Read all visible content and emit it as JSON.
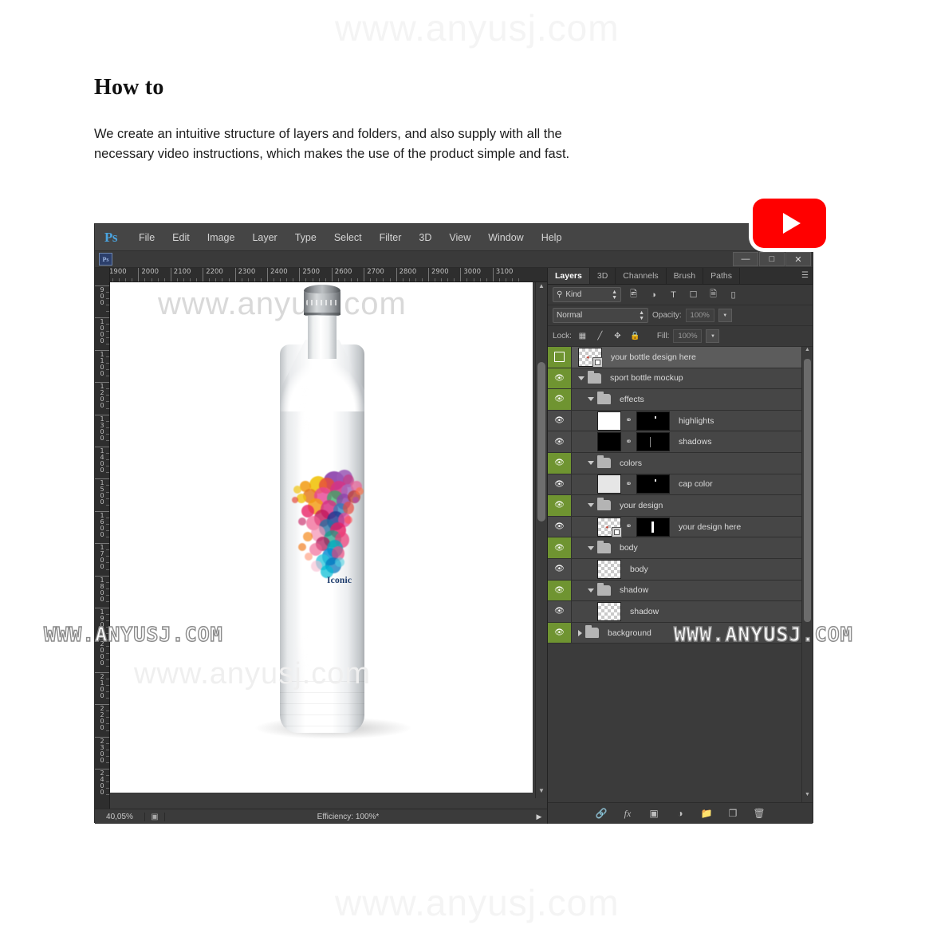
{
  "page": {
    "heading": "How to",
    "body": "We create an intuitive structure of layers and folders, and also supply with all the necessary video instructions, which makes the use of the product simple and fast.",
    "watermark_lower": "www.anyusj.com",
    "watermark_upper": "WWW.ANYUSJ.COM"
  },
  "youtube": {
    "name": "youtube-play-button"
  },
  "photoshop": {
    "app_logo": "Ps",
    "menu": [
      "File",
      "Edit",
      "Image",
      "Layer",
      "Type",
      "Select",
      "Filter",
      "3D",
      "View",
      "Window",
      "Help"
    ],
    "window_controls": {
      "minimize": "—",
      "maximize": "□",
      "close": "✕"
    },
    "document_icon": "Ps",
    "ruler_h": {
      "ticks": [
        1900,
        2000,
        2100,
        2200,
        2300,
        2400,
        2500,
        2600,
        2700,
        2800,
        2900,
        3000,
        3100
      ],
      "unit": "px"
    },
    "ruler_v": {
      "ticks": [
        900,
        1000,
        1100,
        1200,
        1300,
        1400,
        1500,
        1600,
        1700,
        1800,
        1900,
        2000,
        2100,
        2200,
        2300,
        2400
      ]
    },
    "status": {
      "zoom": "40,05%",
      "efficiency": "Efficiency: 100%*"
    },
    "canvas": {
      "product": "sport bottle",
      "artwork_label": "Iconic",
      "artwork_name": "watercolor-runner-splash"
    }
  },
  "layers_panel": {
    "tabs": [
      {
        "label": "Layers",
        "active": true
      },
      {
        "label": "3D",
        "active": false
      },
      {
        "label": "Channels",
        "active": false
      },
      {
        "label": "Brush",
        "active": false
      },
      {
        "label": "Paths",
        "active": false
      }
    ],
    "filter": {
      "kind_label": "Kind",
      "icons": [
        "pixel-layer-filter-icon",
        "adjustment-layer-filter-icon",
        "type-layer-filter-icon",
        "shape-layer-filter-icon",
        "smart-object-filter-icon",
        "gradient-filter-icon"
      ]
    },
    "blend_mode": "Normal",
    "opacity_label": "Opacity:",
    "opacity_value": "100%",
    "lock_label": "Lock:",
    "lock_icons": [
      "lock-transparent-pixels-icon",
      "lock-image-pixels-icon",
      "lock-position-icon",
      "lock-all-icon"
    ],
    "fill_label": "Fill:",
    "fill_value": "100%",
    "rows": [
      {
        "name": "your bottle design here",
        "type": "layer",
        "indent": 0,
        "visible": true,
        "selected": true,
        "eye": "select-square",
        "thumb": "transparent",
        "smart": true,
        "mask": false
      },
      {
        "name": "sport bottle mockup",
        "type": "group",
        "indent": 0,
        "visible": true,
        "selected": false,
        "eye": "eye",
        "thumb": "folder",
        "smart": false,
        "mask": false,
        "expanded": true
      },
      {
        "name": "effects",
        "type": "group",
        "indent": 1,
        "visible": true,
        "selected": false,
        "eye": "eye",
        "thumb": "folder",
        "smart": false,
        "mask": false,
        "expanded": true
      },
      {
        "name": "highlights",
        "type": "layer",
        "indent": 2,
        "visible": false,
        "selected": false,
        "eye": "eye",
        "thumb": "white",
        "smart": false,
        "mask": true
      },
      {
        "name": "shadows",
        "type": "layer",
        "indent": 2,
        "visible": false,
        "selected": false,
        "eye": "eye",
        "thumb": "black",
        "smart": false,
        "mask": true
      },
      {
        "name": "colors",
        "type": "group",
        "indent": 1,
        "visible": true,
        "selected": false,
        "eye": "eye",
        "thumb": "folder",
        "smart": false,
        "mask": false,
        "expanded": true
      },
      {
        "name": "cap color",
        "type": "layer",
        "indent": 2,
        "visible": false,
        "selected": false,
        "eye": "eye",
        "thumb": "lightgray",
        "smart": false,
        "mask": true
      },
      {
        "name": "your design",
        "type": "group",
        "indent": 1,
        "visible": true,
        "selected": false,
        "eye": "eye",
        "thumb": "folder",
        "smart": false,
        "mask": false,
        "expanded": true
      },
      {
        "name": "your design here",
        "type": "layer",
        "indent": 2,
        "visible": false,
        "selected": false,
        "eye": "eye",
        "thumb": "transparent",
        "smart": true,
        "mask": true
      },
      {
        "name": "body",
        "type": "group",
        "indent": 1,
        "visible": true,
        "selected": false,
        "eye": "eye",
        "thumb": "folder",
        "smart": false,
        "mask": false,
        "expanded": true
      },
      {
        "name": "body",
        "type": "layer",
        "indent": 2,
        "visible": false,
        "selected": false,
        "eye": "eye",
        "thumb": "transparent",
        "smart": false,
        "mask": false
      },
      {
        "name": "shadow",
        "type": "group",
        "indent": 1,
        "visible": true,
        "selected": false,
        "eye": "eye",
        "thumb": "folder",
        "smart": false,
        "mask": false,
        "expanded": true
      },
      {
        "name": "shadow",
        "type": "layer",
        "indent": 2,
        "visible": false,
        "selected": false,
        "eye": "eye",
        "thumb": "transparent",
        "smart": false,
        "mask": false
      },
      {
        "name": "background",
        "type": "group",
        "indent": 0,
        "visible": true,
        "selected": false,
        "eye": "eye",
        "thumb": "folder",
        "smart": false,
        "mask": false,
        "expanded": false
      }
    ],
    "bottom_icons": [
      "link-layers-icon",
      "layer-style-fx-icon",
      "add-layer-mask-icon",
      "new-adjustment-layer-icon",
      "new-group-icon",
      "new-layer-icon",
      "delete-layer-icon"
    ]
  },
  "colors": {
    "youtube_red": "#ff0000",
    "eye_green": "#6f9431",
    "panel_bg": "#393939",
    "row_bg": "#464646",
    "accent_blue": "#4aa3df"
  }
}
